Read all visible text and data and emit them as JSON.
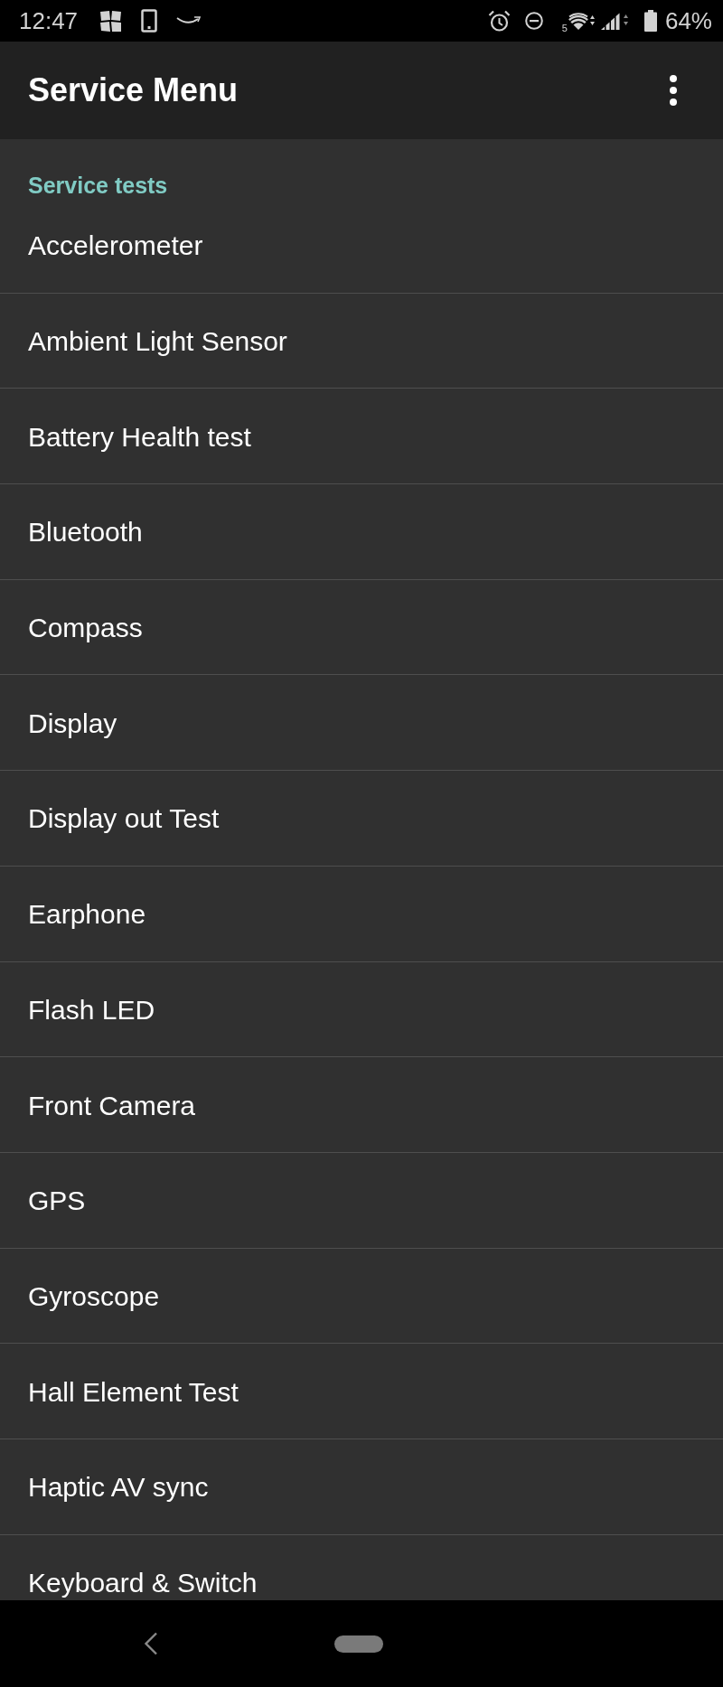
{
  "status_bar": {
    "time": "12:47",
    "wifi_band": "5",
    "battery": "64%"
  },
  "app_bar": {
    "title": "Service Menu"
  },
  "list": {
    "header": "Service tests",
    "items": [
      "Accelerometer",
      "Ambient Light Sensor",
      "Battery Health test",
      "Bluetooth",
      "Compass",
      "Display",
      "Display out Test",
      "Earphone",
      "Flash LED",
      "Front Camera",
      "GPS",
      "Gyroscope",
      "Hall Element Test",
      "Haptic AV sync",
      "Keyboard & Switch"
    ]
  }
}
